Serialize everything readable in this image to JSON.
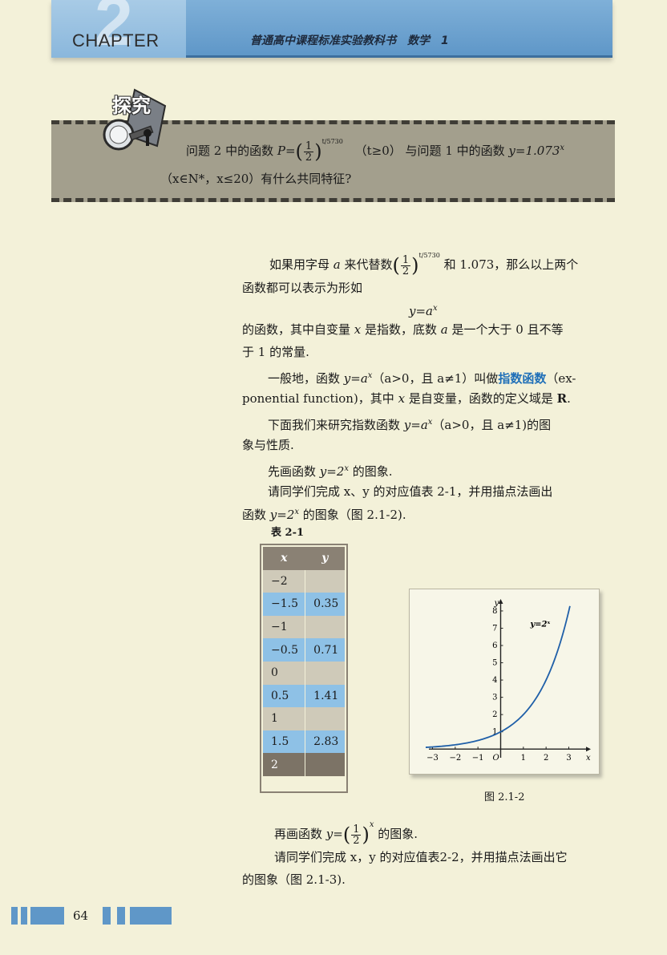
{
  "header": {
    "chapter_num": "2",
    "chapter_word": "CHAPTER",
    "series_title": "普通高中课程标准实验教科书　数学　1"
  },
  "explore": {
    "label": "探究",
    "line1_a": "问题 2 中的函数 ",
    "line1_P": "P=",
    "frac_num": "1",
    "frac_den": "2",
    "exp": "t/5730",
    "line1_cond": "（t≥0）",
    "line1_b": "与问题 1 中的函数 ",
    "line1_y": "y=1.073",
    "line1_yexp": "x",
    "line2": "（x∈N*，x≤20）有什么共同特征?"
  },
  "body": {
    "p1_a": "如果用字母 ",
    "p1_a_var": "a",
    "p1_b": " 来代替数",
    "p1_frac_num": "1",
    "p1_frac_den": "2",
    "p1_exp": "t/5730",
    "p1_c": " 和 1.073，那么以上两个",
    "p2": "函数都可以表示为形如",
    "formula": "y=a",
    "formula_exp": "x",
    "p3_a": "的函数，其中自变量 ",
    "p3_x": "x",
    "p3_b": " 是指数，底数 ",
    "p3_a2": "a",
    "p3_c": " 是一个大于 0 且不等",
    "p4": "于 1 的常量.",
    "p5_a": "一般地，函数 ",
    "p5_f": "y=a",
    "p5_fexp": "x",
    "p5_b": "（a>0，且 a≠1）叫做",
    "p5_term": "指数函数",
    "p5_c": "（ex-",
    "p6_a": "ponential function)，其中 ",
    "p6_x": "x",
    "p6_b": " 是自变量，函数的定义域是 ",
    "p6_R": "R",
    "p6_c": ".",
    "p7_a": "下面我们来研究指数函数 ",
    "p7_f": "y=a",
    "p7_fexp": "x",
    "p7_b": "（a>0，且 a≠1)的图",
    "p8": "象与性质.",
    "p9_a": "先画函数 ",
    "p9_f": "y=2",
    "p9_fexp": "x",
    "p9_b": " 的图象.",
    "p10": "请同学们完成 x、y 的对应值表 2-1，并用描点法画出",
    "p11_a": "函数 ",
    "p11_f": "y=2",
    "p11_fexp": "x",
    "p11_b": " 的图象（图 2.1-2).",
    "table_caption": "表 2-1",
    "p12_a": "再画函数 ",
    "p12_y": "y=",
    "p12_frac_num": "1",
    "p12_frac_den": "2",
    "p12_exp": "x",
    "p12_b": " 的图象.",
    "p13": "请同学们完成 x，y 的对应值表2-2，并用描点法画出它",
    "p14": "的图象（图 2.1-3)."
  },
  "table": {
    "headers": [
      "x",
      "y"
    ],
    "rows": [
      [
        "−2",
        ""
      ],
      [
        "−1.5",
        "0.35"
      ],
      [
        "−1",
        ""
      ],
      [
        "−0.5",
        "0.71"
      ],
      [
        "0",
        ""
      ],
      [
        "0.5",
        "1.41"
      ],
      [
        "1",
        ""
      ],
      [
        "1.5",
        "2.83"
      ],
      [
        "2",
        ""
      ]
    ]
  },
  "figure": {
    "caption": "图 2.1-2",
    "curve_label": "y=2ˣ",
    "axis_x_label": "x",
    "axis_y_label": "y",
    "origin_label": "O",
    "x_ticks": [
      "−3",
      "−2",
      "−1",
      "1",
      "2",
      "3"
    ],
    "y_ticks": [
      "1",
      "2",
      "3",
      "4",
      "5",
      "6",
      "7",
      "8"
    ]
  },
  "chart_data": {
    "type": "line",
    "series": [
      {
        "name": "y=2ˣ",
        "function": "2^x",
        "x_range": [
          -3.3,
          3.05
        ]
      }
    ],
    "xlabel": "x",
    "ylabel": "y",
    "xlim": [
      -3.3,
      3.9
    ],
    "ylim": [
      -0.5,
      8.6
    ],
    "x_ticks": [
      -3,
      -2,
      -1,
      1,
      2,
      3
    ],
    "y_ticks": [
      1,
      2,
      3,
      4,
      5,
      6,
      7,
      8
    ],
    "grid": false,
    "curve_color": "#1f5fa8"
  },
  "footer": {
    "page_number": "64"
  },
  "colors": {
    "page_bg": "#f3f1d9",
    "banner_blue": "#5f97c8",
    "explore_bg": "#a39f8d",
    "term_blue": "#1f6fb8",
    "table_blue": "#8ec1e6",
    "table_gray": "#cfcab9",
    "table_dark": "#7c7366"
  }
}
